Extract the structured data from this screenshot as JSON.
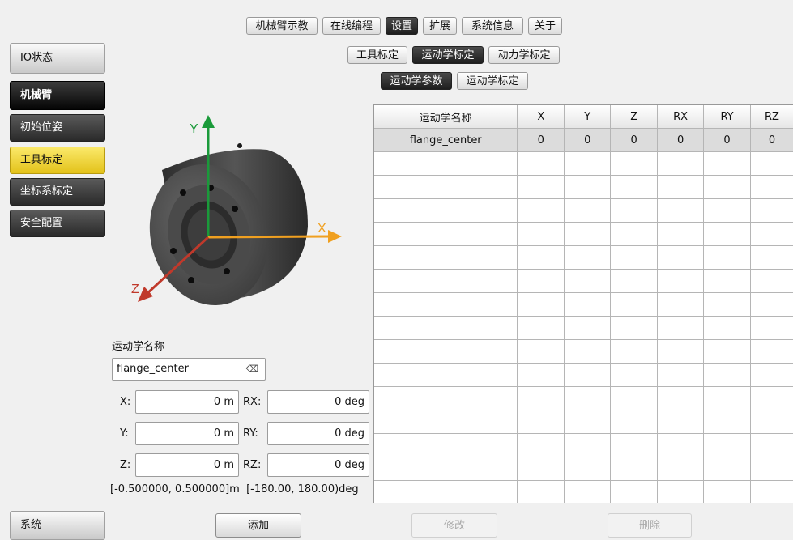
{
  "top_tabs": [
    "机械臂示教",
    "在线编程",
    "设置",
    "扩展",
    "系统信息",
    "关于"
  ],
  "sub_tabs": [
    "工具标定",
    "运动学标定",
    "动力学标定"
  ],
  "sub_sub_tabs": [
    "运动学参数",
    "运动学标定"
  ],
  "sidebar": {
    "io": "IO状态",
    "arm": "机械臂",
    "items": [
      "初始位姿",
      "工具标定",
      "坐标系标定",
      "安全配置"
    ],
    "system": "系统"
  },
  "diagram": {
    "x_axis": "X",
    "y_axis": "Y",
    "z_axis": "Z"
  },
  "table": {
    "headers": [
      "运动学名称",
      "X",
      "Y",
      "Z",
      "RX",
      "RY",
      "RZ"
    ],
    "rows": [
      [
        "flange_center",
        "0",
        "0",
        "0",
        "0",
        "0",
        "0"
      ]
    ]
  },
  "form": {
    "name_label": "运动学名称",
    "name_value": "flange_center",
    "x_label": "X:",
    "x_value": "0 m",
    "y_label": "Y:",
    "y_value": "0 m",
    "z_label": "Z:",
    "z_value": "0 m",
    "rx_label": "RX:",
    "rx_value": "0 deg",
    "ry_label": "RY:",
    "ry_value": "0 deg",
    "rz_label": "RZ:",
    "rz_value": "0 deg",
    "range_text": "[-0.500000, 0.500000]m  [-180.00, 180.00)deg"
  },
  "buttons": {
    "add": "添加",
    "modify": "修改",
    "delete": "删除"
  },
  "colors": {
    "y_axis": "#1a9a3a",
    "x_axis": "#f0a020",
    "z_axis": "#c0392b",
    "selected_side": "#f0cf3a"
  }
}
